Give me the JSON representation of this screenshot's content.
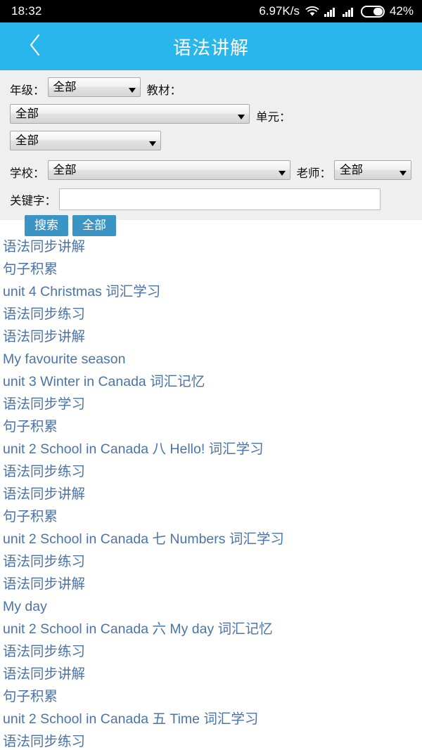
{
  "statusbar": {
    "time": "18:32",
    "network_speed": "6.97K/s",
    "battery_percent": "42%",
    "icons": {
      "wifi": "wifi-icon",
      "signal1": "signal-bars-icon",
      "signal2": "signal-bars-icon",
      "battery": "battery-icon"
    }
  },
  "header": {
    "title": "语法讲解",
    "back_icon": "chevron-left-icon",
    "bar_color": "#29b6ed"
  },
  "filters": {
    "grade": {
      "label": "年级：",
      "value": "全部"
    },
    "textbook": {
      "label": "教材：",
      "value": "全部"
    },
    "unit": {
      "label": "单元：",
      "value": "全部"
    },
    "school": {
      "label": "学校：",
      "value": "全部"
    },
    "teacher": {
      "label": "老师：",
      "value": "全部"
    },
    "keyword": {
      "label": "关键字：",
      "value": "",
      "placeholder": ""
    },
    "search_button": "搜索",
    "all_button": "全部",
    "button_color": "#3a95c4",
    "panel_color": "#efefef"
  },
  "results": {
    "link_color": "#4a74a8",
    "items": [
      "语法同步讲解",
      "句子积累",
      "unit 4 Christmas 词汇学习",
      "语法同步练习",
      "语法同步讲解",
      "My favourite season",
      "unit 3 Winter in Canada 词汇记忆",
      "语法同步学习",
      "句子积累",
      "unit 2 School in Canada 八 Hello! 词汇学习",
      "语法同步练习",
      "语法同步讲解",
      "句子积累",
      "unit 2 School in Canada 七 Numbers 词汇学习",
      "语法同步练习",
      "语法同步讲解",
      "My day",
      "unit 2 School in Canada 六 My day 词汇记忆",
      "语法同步练习",
      "语法同步讲解",
      "句子积累",
      "unit 2 School in Canada 五 Time 词汇学习",
      "语法同步练习"
    ]
  }
}
